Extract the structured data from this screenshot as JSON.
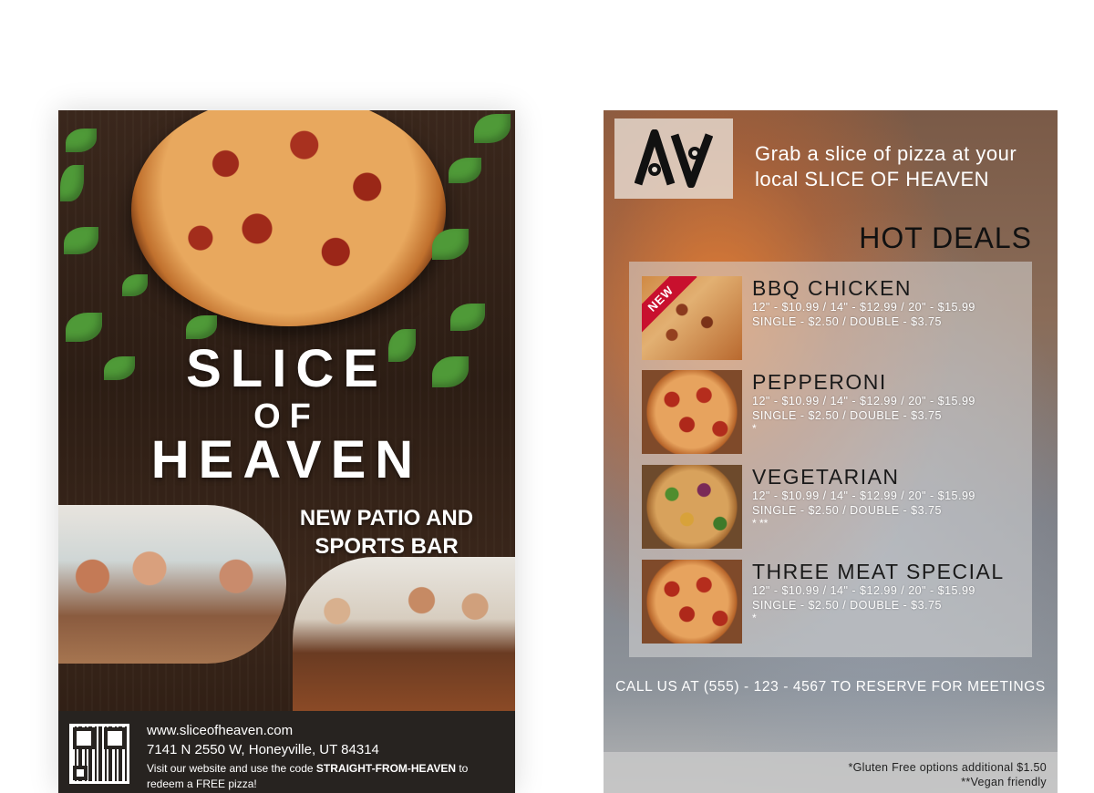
{
  "left_flyer": {
    "brand": {
      "line1": "SLICE",
      "line2": "OF",
      "line3": "HEAVEN"
    },
    "patio_line1": "NEW PATIO AND",
    "patio_line2": "SPORTS BAR",
    "footer": {
      "website": "www.sliceofheaven.com",
      "address": "7141 N 2550 W, Honeyville, UT 84314",
      "promo_prefix": "Visit our website and use the code ",
      "promo_code": "STRAIGHT-FROM-HEAVEN",
      "promo_suffix": " to",
      "promo_line2": "redeem a FREE pizza!"
    }
  },
  "right_flyer": {
    "tagline_line1": "Grab a slice of pizza at your",
    "tagline_line2": "local SLICE OF HEAVEN",
    "hot_deals_title": "HOT DEALS",
    "deals": [
      {
        "name": "BBQ CHICKEN",
        "badge": "NEW",
        "prices": "12\" - $10.99 / 14\" - $12.99 / 20\" - $15.99",
        "slices": "SINGLE - $2.50 / DOUBLE - $3.75",
        "marks": ""
      },
      {
        "name": "PEPPERONI",
        "prices": "12\" - $10.99 / 14\" - $12.99 / 20\" - $15.99",
        "slices": "SINGLE - $2.50 / DOUBLE - $3.75",
        "marks": "*"
      },
      {
        "name": "VEGETARIAN",
        "prices": "12\" - $10.99 / 14\" - $12.99 / 20\" - $15.99",
        "slices": "SINGLE - $2.50 / DOUBLE - $3.75",
        "marks": "* **"
      },
      {
        "name": "THREE MEAT SPECIAL",
        "prices": "12\" - $10.99 / 14\" - $12.99 / 20\" - $15.99",
        "slices": "SINGLE - $2.50 / DOUBLE - $3.75",
        "marks": "*"
      }
    ],
    "call_text": "CALL US AT (555) - 123 - 4567 TO RESERVE FOR MEETINGS",
    "footnote1": "*Gluten Free options additional $1.50",
    "footnote2": "**Vegan friendly"
  },
  "colors": {
    "badge_red": "#c8102e",
    "wood_dark": "#2c1d14",
    "leaf_green": "#4f9a38"
  }
}
